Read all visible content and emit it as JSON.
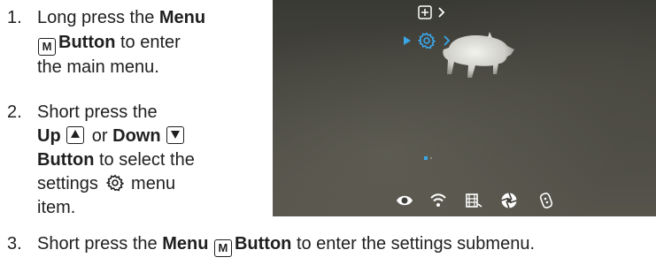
{
  "steps": [
    {
      "number": "1.",
      "line1_a": "Long press the ",
      "line1_b": "Menu",
      "key_label": "M",
      "line2_b": "Button",
      "line2_a": " to enter",
      "line3": "the main menu."
    },
    {
      "number": "2.",
      "line1": "Short press the",
      "line2_up": "Up",
      "line2_or": " or ",
      "line2_down": "Down",
      "line3_b": "Button",
      "line3_a": " to select the",
      "line4_a": "settings",
      "line4_b": " menu",
      "line5": "item."
    },
    {
      "number": "3.",
      "text_a": "Short press the ",
      "text_b": "Menu",
      "key_label": "M",
      "text_c": "Button",
      "text_d": " to enter the settings submenu."
    }
  ],
  "screen": {
    "top_menu_icons": [
      "add-square-icon",
      "chevron-right-icon",
      "gear-icon"
    ],
    "bottom_icons": [
      "eye-icon",
      "wifi-icon",
      "film-icon",
      "aperture-icon",
      "remote-icon"
    ],
    "accent_color": "#3aa6e8"
  }
}
